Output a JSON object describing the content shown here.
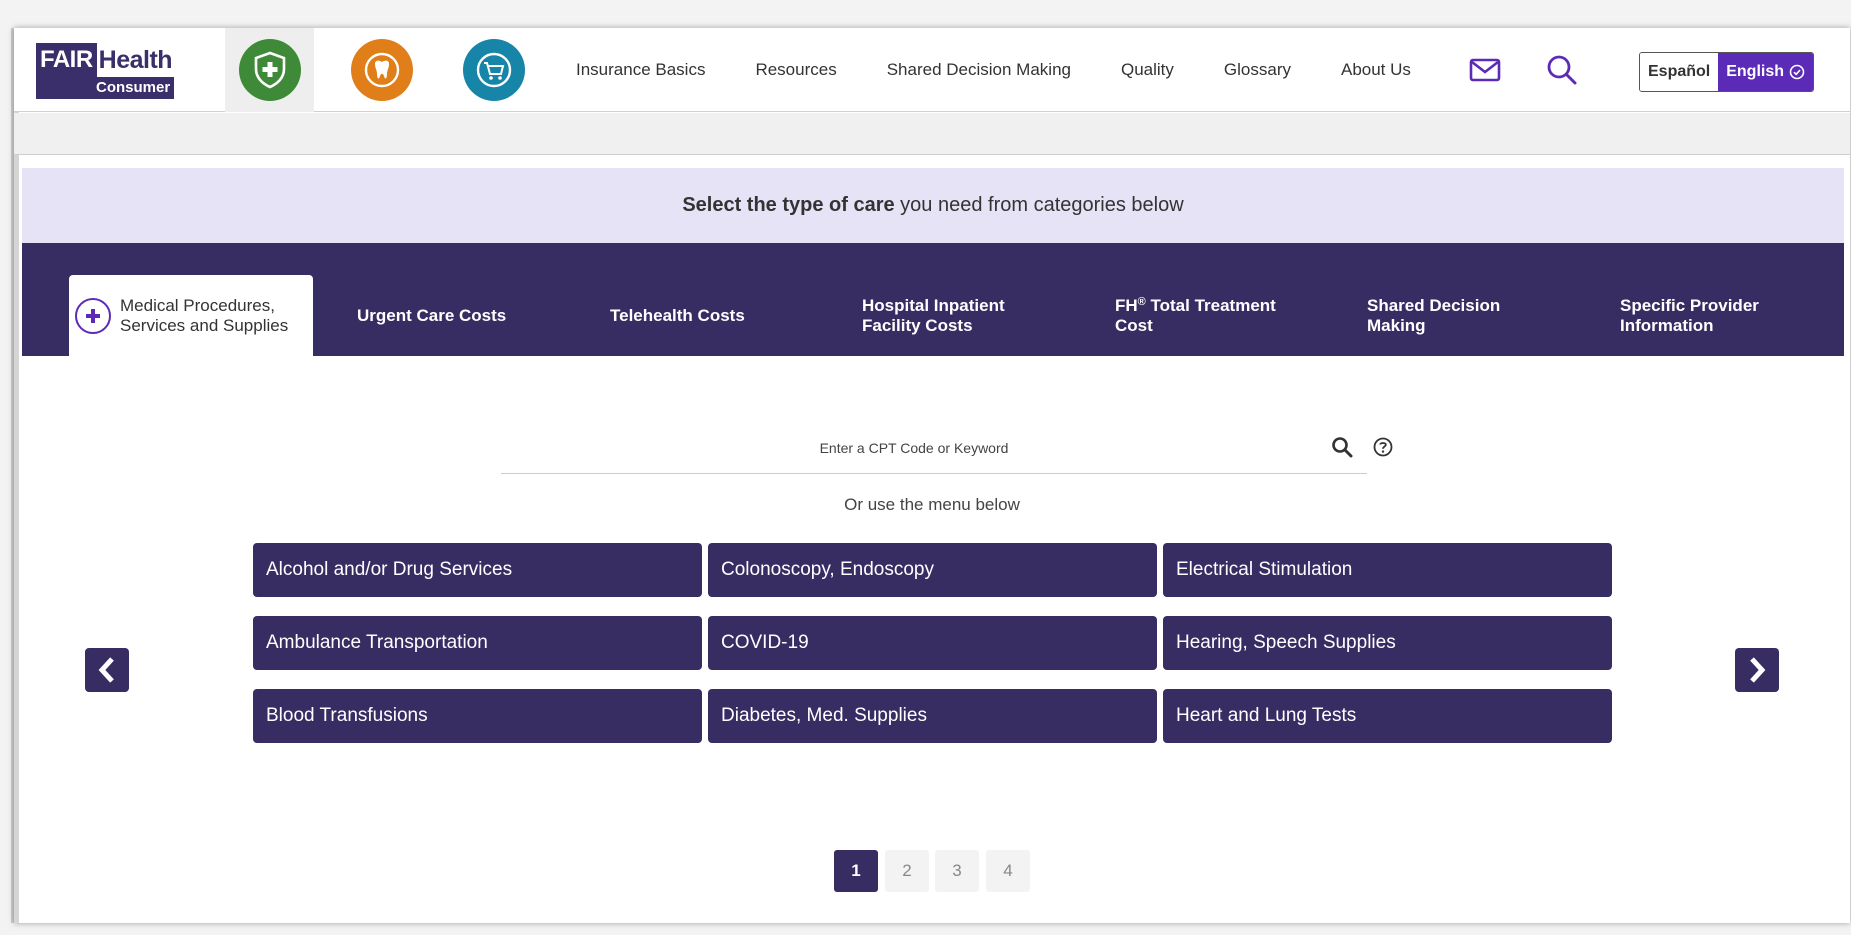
{
  "header": {
    "logo": {
      "brand_left": "FAIR",
      "brand_right": "Health",
      "sub": "Consumer"
    },
    "insurance_icons": [
      {
        "name": "medical-shield-icon",
        "color": "#3f8a38"
      },
      {
        "name": "dental-tooth-icon",
        "color": "#e07f1a"
      },
      {
        "name": "cart-icon",
        "color": "#1685a8"
      }
    ],
    "nav": [
      "Insurance Basics",
      "Resources",
      "Shared Decision Making",
      "Quality",
      "Glossary",
      "About Us"
    ],
    "language": {
      "spanish": "Español",
      "english": "English"
    }
  },
  "band": {
    "bold_text": "Select the type of care",
    "rest_text": " you need from categories below"
  },
  "tabs": {
    "medical_line1": "Medical Procedures,",
    "medical_line2": "Services and Supplies",
    "urgent": "Urgent Care Costs",
    "telehealth": "Telehealth Costs",
    "hospital_line1": "Hospital Inpatient",
    "hospital_line2": "Facility Costs",
    "fh_prefix": "FH",
    "fh_sup": "®",
    "fh_line1_rest": " Total Treatment",
    "fh_line2": "Cost",
    "sdm_line1": "Shared Decision",
    "sdm_line2": "Making",
    "provider_line1": "Specific Provider",
    "provider_line2": "Information"
  },
  "search": {
    "placeholder": "Enter a CPT Code or Keyword",
    "or_text": "Or use the menu below"
  },
  "categories": [
    "Alcohol and/or Drug Services",
    "Colonoscopy, Endoscopy",
    "Electrical Stimulation",
    "Ambulance Transportation",
    "COVID-19",
    "Hearing, Speech Supplies",
    "Blood Transfusions",
    "Diabetes, Med. Supplies",
    "Heart and Lung Tests"
  ],
  "pagination": [
    "1",
    "2",
    "3",
    "4"
  ],
  "colors": {
    "primary": "#372d63",
    "accent": "#5b2bb8",
    "band": "#e6e3f6"
  }
}
